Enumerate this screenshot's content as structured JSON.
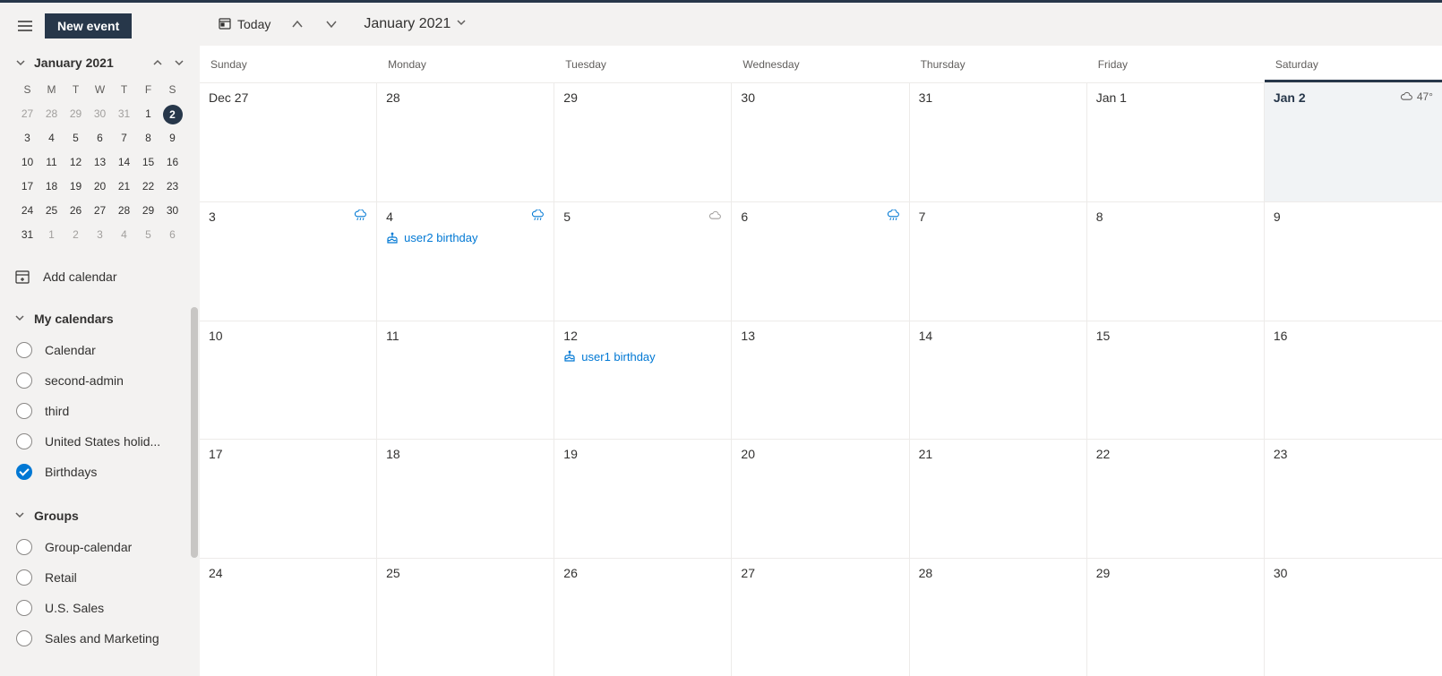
{
  "header": {
    "new_event": "New event",
    "today_label": "Today",
    "month_label": "January 2021"
  },
  "mini_cal": {
    "month_label": "January 2021",
    "dow": [
      "S",
      "M",
      "T",
      "W",
      "T",
      "F",
      "S"
    ],
    "rows": [
      [
        {
          "n": "27",
          "other": true
        },
        {
          "n": "28",
          "other": true
        },
        {
          "n": "29",
          "other": true
        },
        {
          "n": "30",
          "other": true
        },
        {
          "n": "31",
          "other": true
        },
        {
          "n": "1"
        },
        {
          "n": "2",
          "today": true
        }
      ],
      [
        {
          "n": "3"
        },
        {
          "n": "4"
        },
        {
          "n": "5"
        },
        {
          "n": "6"
        },
        {
          "n": "7"
        },
        {
          "n": "8"
        },
        {
          "n": "9"
        }
      ],
      [
        {
          "n": "10"
        },
        {
          "n": "11"
        },
        {
          "n": "12"
        },
        {
          "n": "13"
        },
        {
          "n": "14"
        },
        {
          "n": "15"
        },
        {
          "n": "16"
        }
      ],
      [
        {
          "n": "17"
        },
        {
          "n": "18"
        },
        {
          "n": "19"
        },
        {
          "n": "20"
        },
        {
          "n": "21"
        },
        {
          "n": "22"
        },
        {
          "n": "23"
        }
      ],
      [
        {
          "n": "24"
        },
        {
          "n": "25"
        },
        {
          "n": "26"
        },
        {
          "n": "27"
        },
        {
          "n": "28"
        },
        {
          "n": "29"
        },
        {
          "n": "30"
        }
      ],
      [
        {
          "n": "31"
        },
        {
          "n": "1",
          "other": true
        },
        {
          "n": "2",
          "other": true
        },
        {
          "n": "3",
          "other": true
        },
        {
          "n": "4",
          "other": true
        },
        {
          "n": "5",
          "other": true
        },
        {
          "n": "6",
          "other": true
        }
      ]
    ]
  },
  "add_calendar_label": "Add calendar",
  "sections": [
    {
      "title": "My calendars",
      "items": [
        {
          "label": "Calendar",
          "checked": false
        },
        {
          "label": "second-admin",
          "checked": false
        },
        {
          "label": "third",
          "checked": false
        },
        {
          "label": "United States holid...",
          "checked": false
        },
        {
          "label": "Birthdays",
          "checked": true
        }
      ]
    },
    {
      "title": "Groups",
      "items": [
        {
          "label": "Group-calendar",
          "checked": false
        },
        {
          "label": "Retail",
          "checked": false
        },
        {
          "label": "U.S. Sales",
          "checked": false
        },
        {
          "label": "Sales and Marketing",
          "checked": false
        }
      ]
    }
  ],
  "dow_full": [
    "Sunday",
    "Monday",
    "Tuesday",
    "Wednesday",
    "Thursday",
    "Friday",
    "Saturday"
  ],
  "today_index": 6,
  "weeks": [
    [
      {
        "label": "Dec 27"
      },
      {
        "label": "28"
      },
      {
        "label": "29"
      },
      {
        "label": "30"
      },
      {
        "label": "31"
      },
      {
        "label": "Jan 1"
      },
      {
        "label": "Jan 2",
        "today": true,
        "weather": {
          "icon": "cloud",
          "temp": "47°"
        }
      }
    ],
    [
      {
        "label": "3",
        "weather": {
          "icon": "rain"
        }
      },
      {
        "label": "4",
        "weather": {
          "icon": "rain"
        },
        "events": [
          {
            "text": "user2 birthday"
          }
        ]
      },
      {
        "label": "5",
        "weather": {
          "icon": "cloud-light"
        }
      },
      {
        "label": "6",
        "weather": {
          "icon": "rain"
        }
      },
      {
        "label": "7"
      },
      {
        "label": "8"
      },
      {
        "label": "9"
      }
    ],
    [
      {
        "label": "10"
      },
      {
        "label": "11"
      },
      {
        "label": "12",
        "events": [
          {
            "text": "user1 birthday"
          }
        ]
      },
      {
        "label": "13"
      },
      {
        "label": "14"
      },
      {
        "label": "15"
      },
      {
        "label": "16"
      }
    ],
    [
      {
        "label": "17"
      },
      {
        "label": "18"
      },
      {
        "label": "19"
      },
      {
        "label": "20"
      },
      {
        "label": "21"
      },
      {
        "label": "22"
      },
      {
        "label": "23"
      }
    ],
    [
      {
        "label": "24"
      },
      {
        "label": "25"
      },
      {
        "label": "26"
      },
      {
        "label": "27"
      },
      {
        "label": "28"
      },
      {
        "label": "29"
      },
      {
        "label": "30"
      }
    ]
  ]
}
